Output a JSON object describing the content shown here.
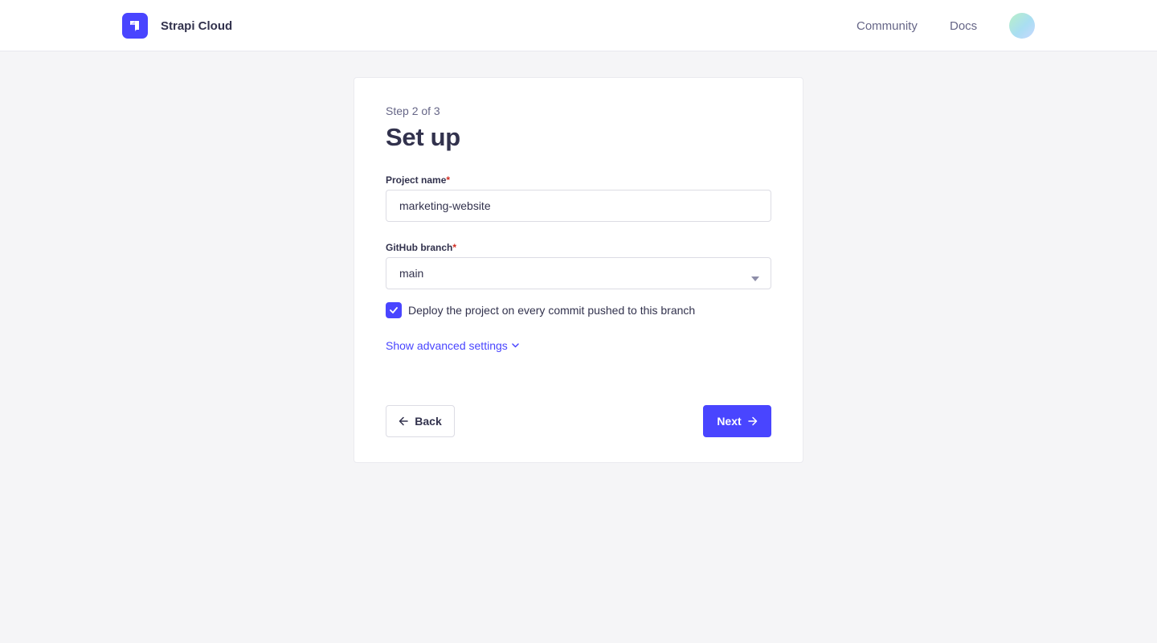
{
  "header": {
    "brand_name": "Strapi Cloud",
    "logo_icon": "strapi-logo-icon",
    "nav": {
      "community": "Community",
      "docs": "Docs"
    },
    "avatar_icon": "user-avatar"
  },
  "form": {
    "step": "Step 2 of 3",
    "title": "Set up",
    "project_name": {
      "label": "Project name",
      "required_mark": "*",
      "value": "marketing-website"
    },
    "github_branch": {
      "label": "GitHub branch",
      "required_mark": "*",
      "selected": "main"
    },
    "auto_deploy": {
      "checked": true,
      "label": "Deploy the project on every commit pushed to this branch"
    },
    "advanced_link": "Show advanced settings",
    "back_label": "Back",
    "next_label": "Next"
  },
  "colors": {
    "primary": "#4945ff",
    "required": "#d02b20",
    "background": "#f5f5f7",
    "text": "#32324d",
    "muted_text": "#666687"
  }
}
